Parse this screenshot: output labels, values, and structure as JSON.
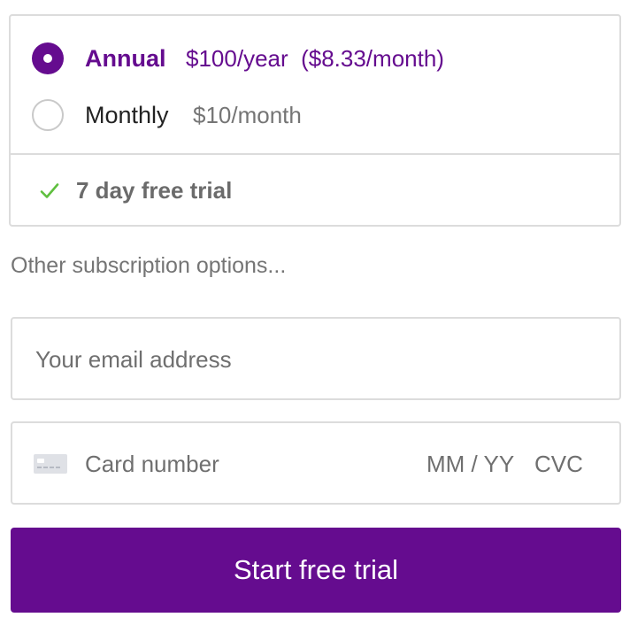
{
  "plans": {
    "annual": {
      "name": "Annual",
      "price": "$100/year  ($8.33/month)",
      "selected": true
    },
    "monthly": {
      "name": "Monthly",
      "price": "$10/month",
      "selected": false
    },
    "trial_text": "7 day free trial"
  },
  "other_options_label": "Other subscription options...",
  "email": {
    "value": "",
    "placeholder": "Your email address"
  },
  "card": {
    "number_placeholder": "Card number",
    "expiry_placeholder": "MM / YY",
    "cvc_placeholder": "CVC"
  },
  "submit_label": "Start free trial",
  "colors": {
    "brand": "#650c8f",
    "check": "#5fbf3f",
    "border": "#dcdcdc"
  },
  "icons": {
    "trial": "check-icon",
    "card": "credit-card-icon"
  }
}
